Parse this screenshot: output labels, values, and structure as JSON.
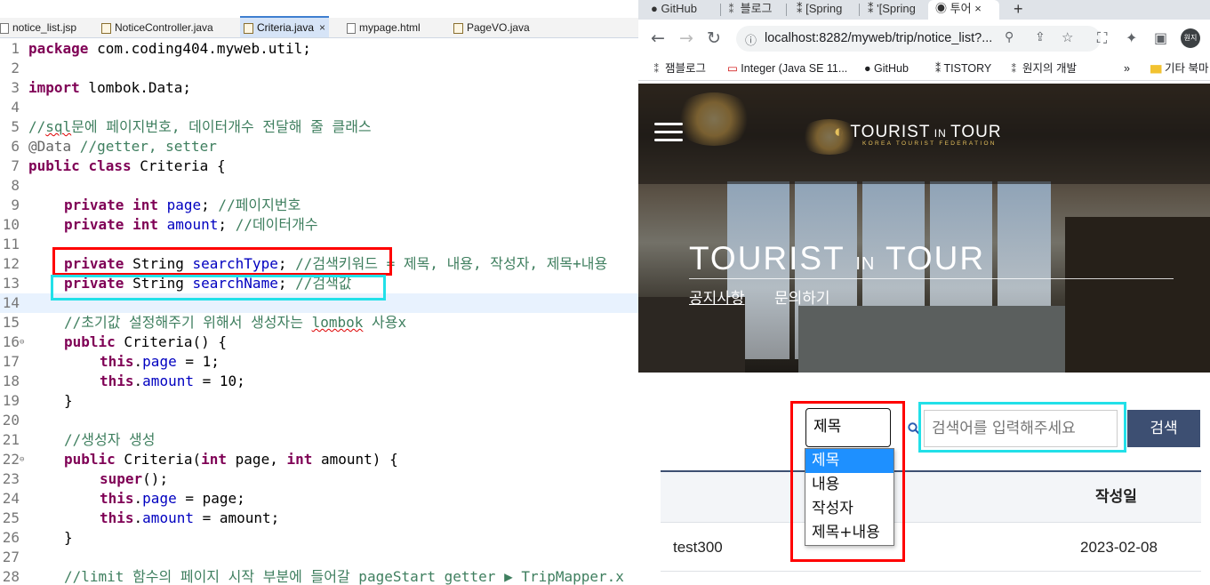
{
  "editor": {
    "tabs": [
      {
        "label": "notice_list.jsp",
        "icon": "jsp-file-icon"
      },
      {
        "label": "NoticeController.java",
        "icon": "java-file-icon"
      },
      {
        "label": "Criteria.java",
        "icon": "java-file-icon",
        "active": true
      },
      {
        "label": "mypage.html",
        "icon": "html-file-icon"
      },
      {
        "label": "PageVO.java",
        "icon": "java-file-icon"
      }
    ],
    "close_glyph": "×",
    "line_numbers": [
      "1",
      "2",
      "3",
      "4",
      "5",
      "6",
      "7",
      "8",
      "9",
      "10",
      "11",
      "12",
      "13",
      "14",
      "15",
      "16",
      "17",
      "18",
      "19",
      "20",
      "21",
      "22",
      "23",
      "24",
      "25",
      "26",
      "27",
      "28"
    ],
    "code": {
      "l1_kw": "package",
      "l1_rest": " com.coding404.myweb.util;",
      "l3_kw": "import",
      "l3_rest": " lombok.Data;",
      "l5_c1": "//",
      "l5_c2": "sql",
      "l5_c3": "문에 페이지번호, 데이터개수 전달해 줄 클래스",
      "l6_an": "@Data",
      "l6_cm": " //getter, setter",
      "l7_kw1": "public",
      "l7_kw2": "class",
      "l7_rest": " Criteria {",
      "l9_kw1": "private",
      "l9_kw2": "int",
      "l9_fld": "page",
      "l9_semi": ";",
      "l9_cm": " //페이지번호",
      "l10_kw1": "private",
      "l10_kw2": "int",
      "l10_fld": "amount",
      "l10_semi": ";",
      "l10_cm": " //데이터개수",
      "l12_kw": "private",
      "l12_type": " String ",
      "l12_fld": "searchType",
      "l12_semi": ";",
      "l12_cm": " //검색키워드 = 제목, 내용, 작성자, 제목+내용",
      "l13_kw": "private",
      "l13_type": " String ",
      "l13_fld": "searchName",
      "l13_semi": ";",
      "l13_cm": " //검색값",
      "l15_c1": "//초기값 설정해주기 위해서 생성자는 ",
      "l15_c2": "lombok",
      "l15_c3": " 사용x",
      "l16_kw": "public",
      "l16_rest": " Criteria() {",
      "l17_kw": "this",
      "l17_dot": ".",
      "l17_fld": "page",
      "l17_rest": " = 1;",
      "l18_kw": "this",
      "l18_dot": ".",
      "l18_fld": "amount",
      "l18_rest": " = 10;",
      "l19": "}",
      "l21_cm": "//생성자 생성",
      "l22_kw1": "public",
      "l22_r1": " Criteria(",
      "l22_kw2": "int",
      "l22_r2": " page, ",
      "l22_kw3": "int",
      "l22_r3": " amount) {",
      "l23_kw": "super",
      "l23_rest": "();",
      "l24_kw": "this",
      "l24_dot": ".",
      "l24_fld": "page",
      "l24_rest": " = page;",
      "l25_kw": "this",
      "l25_dot": ".",
      "l25_fld": "amount",
      "l25_rest": " = amount;",
      "l26": "}",
      "l28_cm": "//limit 함수의 페이지 시작 부분에 들어갈 pageStart getter ▶ TripMapper.x"
    }
  },
  "browser": {
    "tabs": [
      {
        "label": "GitHub",
        "icon": "github-icon"
      },
      {
        "label": "블로그",
        "icon": "blog-icon"
      },
      {
        "label": "[Spring",
        "icon": "blog-icon"
      },
      {
        "label": "'[Spring",
        "icon": "blog-icon"
      },
      {
        "label": "투어",
        "icon": "globe-icon",
        "active": true
      }
    ],
    "tab_close": "×",
    "new_tab": "+",
    "url": "localhost:8282/myweb/trip/notice_list?...",
    "profile_label": "원지",
    "bookmarks": [
      {
        "label": "잼블로그",
        "icon": "blog-icon"
      },
      {
        "label": "Integer (Java SE 11...",
        "icon": "oracle-icon"
      },
      {
        "label": "GitHub",
        "icon": "github-icon"
      },
      {
        "label": "TISTORY",
        "icon": "blog-icon"
      },
      {
        "label": "원지의 개발",
        "icon": "blog-icon"
      }
    ],
    "bookmarks_more": "»",
    "other_bookmarks": "기타 북마"
  },
  "site": {
    "logo_main": "TOURIST",
    "logo_in": " IN ",
    "logo_tour": "TOUR",
    "logo_sub": "KOREA TOURIST FEDERATION",
    "hero_title_1": "TOURIST ",
    "hero_title_in": "IN",
    "hero_title_2": " TOUR",
    "menu": [
      {
        "label": "공지사항",
        "active": true
      },
      {
        "label": "문의하기"
      }
    ],
    "search": {
      "selected": "제목",
      "options": [
        "제목",
        "내용",
        "작성자",
        "제목+내용"
      ],
      "placeholder": "검색어를 입력해주세요",
      "button": "검색"
    },
    "table": {
      "headers": [
        "작성일"
      ],
      "rows": [
        {
          "writer": "test300",
          "date": "2023-02-08"
        }
      ]
    }
  },
  "annotation_colors": {
    "red": "#ff0000",
    "cyan": "#22e0e8"
  }
}
